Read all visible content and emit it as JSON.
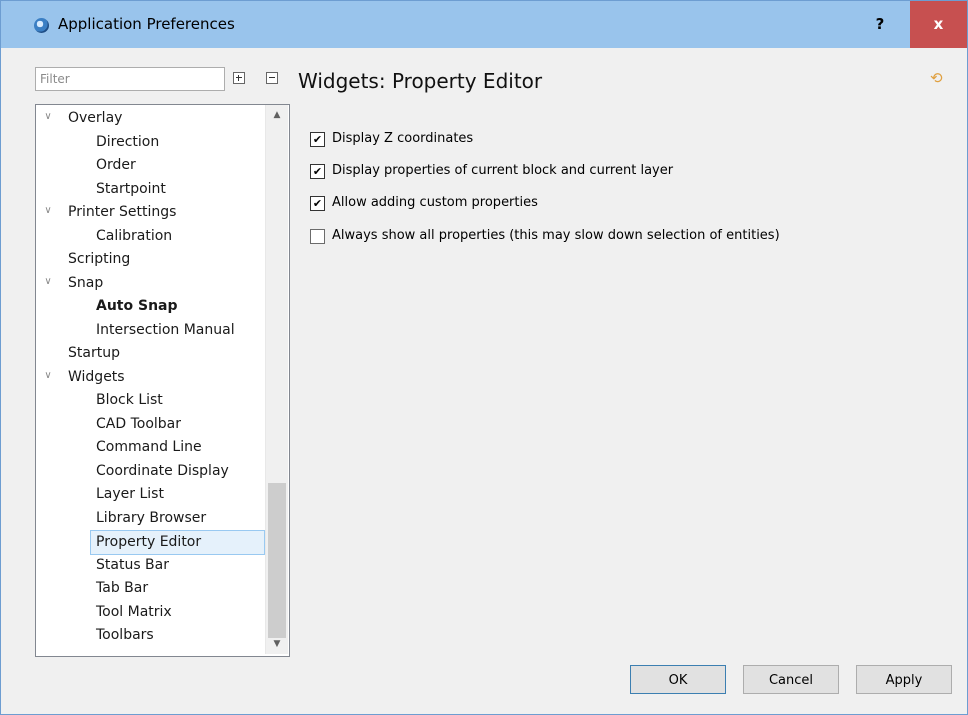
{
  "window": {
    "title": "Application Preferences",
    "help_label": "?",
    "close_label": "x"
  },
  "filter": {
    "placeholder": "Filter",
    "value": ""
  },
  "page": {
    "heading": "Widgets: Property Editor"
  },
  "tree": {
    "items": [
      {
        "label": "Overlay",
        "level": 0,
        "expanded": true
      },
      {
        "label": "Direction",
        "level": 1
      },
      {
        "label": "Order",
        "level": 1
      },
      {
        "label": "Startpoint",
        "level": 1
      },
      {
        "label": "Printer Settings",
        "level": 0,
        "expanded": true
      },
      {
        "label": "Calibration",
        "level": 1
      },
      {
        "label": "Scripting",
        "level": 0
      },
      {
        "label": "Snap",
        "level": 0,
        "expanded": true
      },
      {
        "label": "Auto Snap",
        "level": 1,
        "bold": true
      },
      {
        "label": "Intersection Manual",
        "level": 1
      },
      {
        "label": "Startup",
        "level": 0
      },
      {
        "label": "Widgets",
        "level": 0,
        "expanded": true
      },
      {
        "label": "Block List",
        "level": 1
      },
      {
        "label": "CAD Toolbar",
        "level": 1
      },
      {
        "label": "Command Line",
        "level": 1
      },
      {
        "label": "Coordinate Display",
        "level": 1
      },
      {
        "label": "Layer List",
        "level": 1
      },
      {
        "label": "Library Browser",
        "level": 1
      },
      {
        "label": "Property Editor",
        "level": 1,
        "selected": true
      },
      {
        "label": "Status Bar",
        "level": 1
      },
      {
        "label": "Tab Bar",
        "level": 1
      },
      {
        "label": "Tool Matrix",
        "level": 1
      },
      {
        "label": "Toolbars",
        "level": 1
      }
    ]
  },
  "options": [
    {
      "label": "Display Z coordinates",
      "checked": true
    },
    {
      "label": "Display properties of current block and current layer",
      "checked": true
    },
    {
      "label": "Allow adding custom properties",
      "checked": true
    },
    {
      "label": "Always show all properties (this may slow down selection of entities)",
      "checked": false
    }
  ],
  "buttons": {
    "ok": "OK",
    "cancel": "Cancel",
    "apply": "Apply"
  },
  "icons": {
    "expand_all": "expand-all-icon",
    "collapse_all": "collapse-all-icon",
    "revert": "revert-icon"
  },
  "colors": {
    "titlebar": "#99c4ec",
    "close": "#c75050",
    "selection": "#e5f1fb"
  }
}
